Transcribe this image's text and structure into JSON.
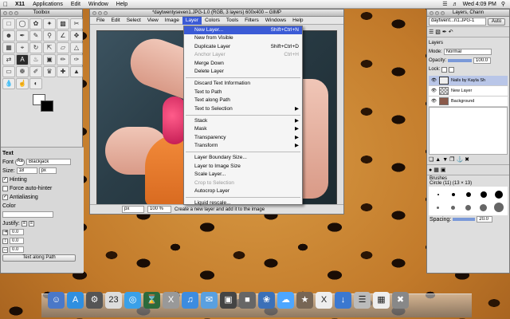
{
  "menubar": {
    "apple_icon": "apple-icon",
    "items": [
      {
        "label": "X11",
        "bold": true
      },
      {
        "label": "Applications"
      },
      {
        "label": "Edit"
      },
      {
        "label": "Window"
      },
      {
        "label": "Help"
      }
    ],
    "clock": "Wed 4:09 PM"
  },
  "toolbox": {
    "title": "Toolbox",
    "options_title": "Text",
    "font_label": "Font",
    "font_value": "Blackjack",
    "size_label": "Size:",
    "size_value": "18",
    "size_unit": "px",
    "hinting": "Hinting",
    "force_autohinter": "Force auto-hinter",
    "antialiasing": "Antialiasing",
    "color_label": "Color",
    "justify_label": "Justify:",
    "indent_value": "0.0",
    "line_value": "0.0",
    "letter_value": "0.0",
    "text_along_path": "Text along Path"
  },
  "image_window": {
    "title": "*daytwentyseven1.JPG-1.0 (RGB, 3 layers) 600x400 – GIMP",
    "menus": [
      "File",
      "Edit",
      "Select",
      "View",
      "Image",
      "Layer",
      "Colors",
      "Tools",
      "Filters",
      "Windows",
      "Help"
    ],
    "open_menu": "Layer",
    "unit": "px",
    "zoom": "100 %",
    "status": "Create a new layer and add it to the image"
  },
  "layer_menu": {
    "items": [
      {
        "label": "New Layer...",
        "shortcut": "Shift+Ctrl+N",
        "highlighted": true
      },
      {
        "label": "New from Visible"
      },
      {
        "label": "Duplicate Layer",
        "shortcut": "Shift+Ctrl+D"
      },
      {
        "label": "Anchor Layer",
        "shortcut": "Ctrl+H",
        "disabled": true
      },
      {
        "label": "Merge Down"
      },
      {
        "label": "Delete Layer"
      },
      {
        "sep": true
      },
      {
        "label": "Discard Text Information"
      },
      {
        "label": "Text to Path"
      },
      {
        "label": "Text along Path"
      },
      {
        "label": "Text to Selection",
        "submenu": true
      },
      {
        "sep": true
      },
      {
        "label": "Stack",
        "submenu": true
      },
      {
        "label": "Mask",
        "submenu": true
      },
      {
        "label": "Transparency",
        "submenu": true
      },
      {
        "label": "Transform",
        "submenu": true
      },
      {
        "sep": true
      },
      {
        "label": "Layer Boundary Size..."
      },
      {
        "label": "Layer to Image Size"
      },
      {
        "label": "Scale Layer..."
      },
      {
        "label": "Crop to Selection",
        "disabled": true
      },
      {
        "label": "Autocrop Layer"
      },
      {
        "sep": true
      },
      {
        "label": "Liquid rescale..."
      }
    ]
  },
  "layers_window": {
    "title": "Layers, Chann",
    "image_select": "daytwent...n1.JPG-1",
    "auto_label": "Auto",
    "section_title": "Layers",
    "mode_label": "Mode:",
    "mode_value": "Normal",
    "opacity_label": "Opacity:",
    "opacity_value": "100.0",
    "lock_label": "Lock:",
    "layers": [
      {
        "name": "Nails by Kayla Sh",
        "selected": true
      },
      {
        "name": "New Layer"
      },
      {
        "name": "Background"
      }
    ],
    "brushes_title": "Brushes",
    "brush_name": "Circle (11) (13 × 13)",
    "spacing_label": "Spacing:",
    "spacing_value": "20.0"
  },
  "dock": {
    "icons": [
      "finder-icon",
      "appstore-icon",
      "dashboard-icon",
      "calendar-icon",
      "safari-icon",
      "timemachine-icon",
      "x11-icon",
      "itunes-icon",
      "mail-icon",
      "photobooth-icon",
      "preview-icon",
      "iphoto-icon",
      "cloud-icon",
      "gimp-icon",
      "x-icon",
      "downloads-folder-icon",
      "documents-icon",
      "applications-stack-icon",
      "trash-icon"
    ]
  }
}
